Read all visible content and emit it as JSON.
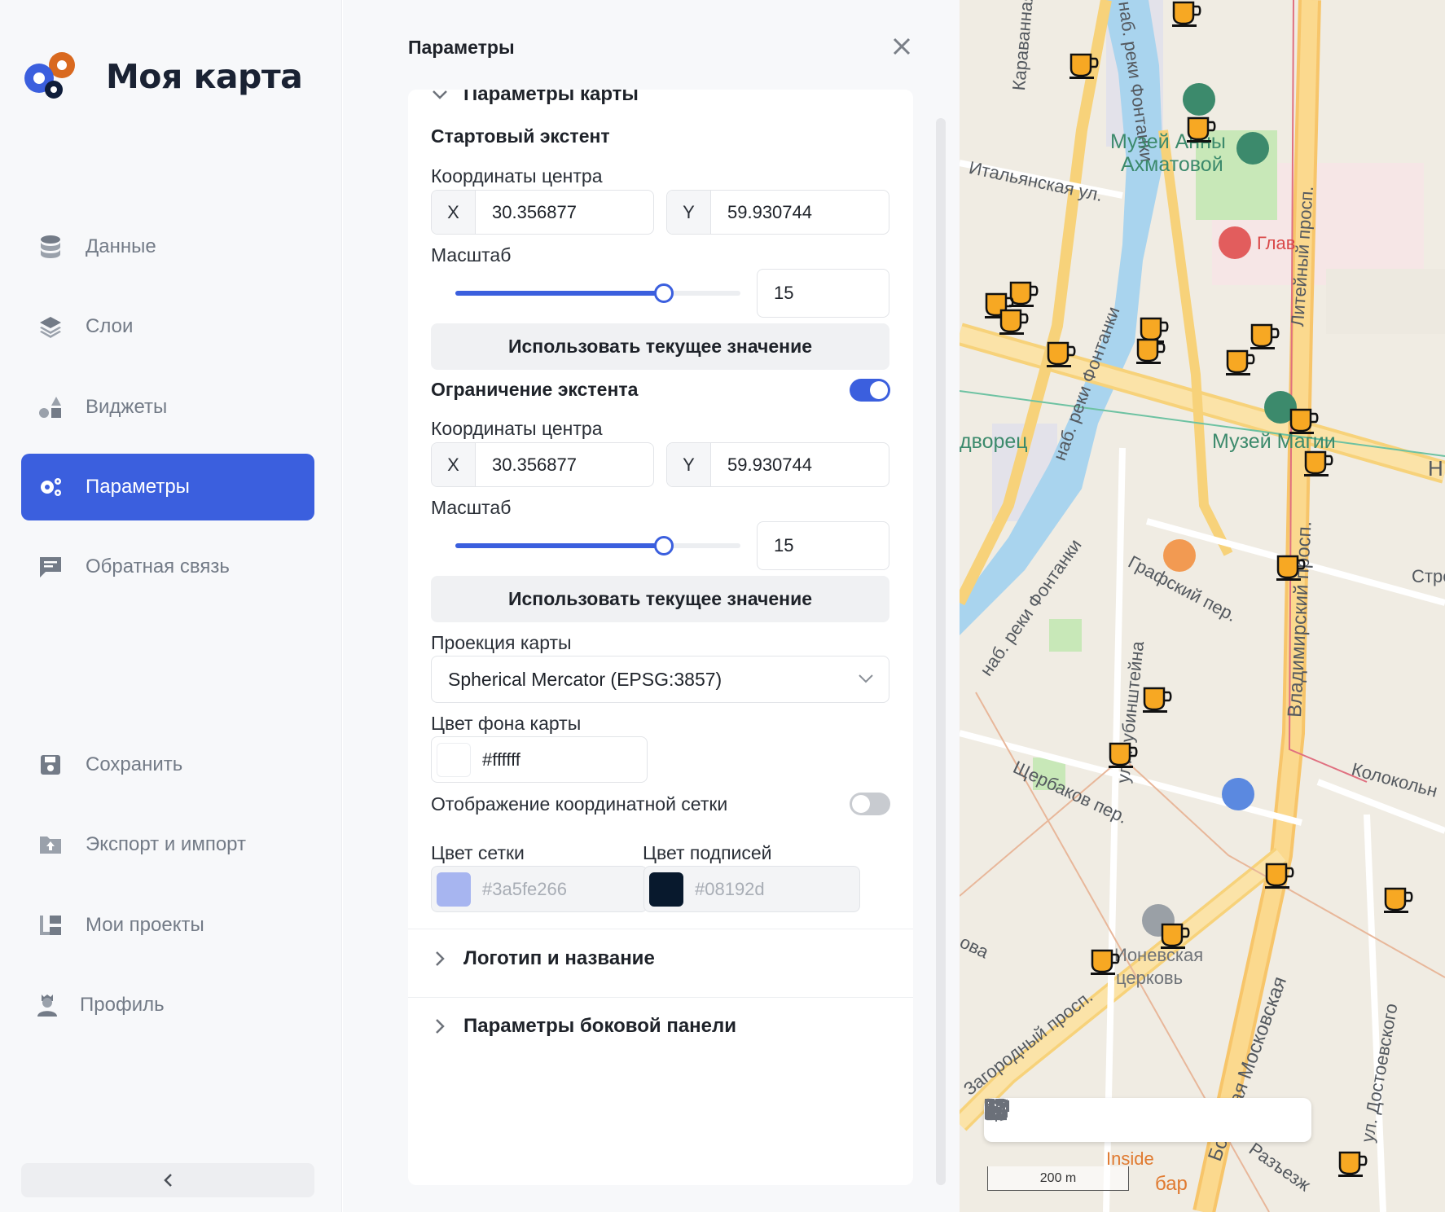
{
  "app": {
    "title": "Моя карта"
  },
  "sidebar": {
    "items": [
      {
        "label": "Данные",
        "icon": "database-icon"
      },
      {
        "label": "Слои",
        "icon": "layers-icon"
      },
      {
        "label": "Виджеты",
        "icon": "widgets-icon"
      },
      {
        "label": "Параметры",
        "icon": "settings-icon",
        "active": true
      },
      {
        "label": "Обратная связь",
        "icon": "feedback-icon"
      }
    ],
    "bottom_items": [
      {
        "label": "Сохранить",
        "icon": "save-icon"
      },
      {
        "label": "Экспорт и импорт",
        "icon": "export-import-icon"
      },
      {
        "label": "Мои проекты",
        "icon": "projects-icon"
      },
      {
        "label": "Профиль",
        "icon": "profile-icon"
      }
    ],
    "accent_color": "#3b5fde"
  },
  "panel": {
    "title": "Параметры",
    "map_params": {
      "header": "Параметры карты",
      "start_extent": {
        "title": "Стартовый экстент",
        "center_label": "Координаты центра",
        "x_prefix": "X",
        "x_value": "30.356877",
        "y_prefix": "Y",
        "y_value": "59.930744",
        "scale_label": "Масштаб",
        "scale_value": "15",
        "slider_fraction": 0.73,
        "use_current_button": "Использовать текущее значение"
      },
      "extent_limit": {
        "title": "Ограничение экстента",
        "toggle_on": true,
        "center_label": "Координаты центра",
        "x_prefix": "X",
        "x_value": "30.356877",
        "y_prefix": "Y",
        "y_value": "59.930744",
        "scale_label": "Масштаб",
        "scale_value": "15",
        "slider_fraction": 0.73,
        "use_current_button": "Использовать текущее значение"
      },
      "projection": {
        "label": "Проекция карты",
        "selected": "Spherical Mercator (EPSG:3857)"
      },
      "background": {
        "label": "Цвет фона карты",
        "value": "#ffffff"
      },
      "grid": {
        "label": "Отображение координатной сетки",
        "toggle_on": false,
        "grid_color_label": "Цвет сетки",
        "grid_color_value": "#3a5fe266",
        "labels_color_label": "Цвет подписей",
        "labels_color_value": "#08192d"
      }
    },
    "sections": [
      {
        "label": "Логотип и название"
      },
      {
        "label": "Параметры боковой панели"
      }
    ]
  },
  "map": {
    "labels": {
      "karavannaya": "Караванная ул.",
      "fontanka_top": "наб. реки Фонтанки",
      "akhmatova_1": "Музей Анны",
      "akhmatova_2": "Ахматовой",
      "italyanskaya": "Итальянская ул.",
      "glav": "Глав",
      "liteyny": "Литейный просп.",
      "fontanka_mid": "наб. реки Фонтанки",
      "dvorets": "дворец",
      "magic_museum": "Музей Магии",
      "h": "Н",
      "fontanka_low": "наб. реки Фонтанки",
      "grafsky": "Графский пер.",
      "stre": "Стре",
      "rubinshteyna": "ул. Рубинштейна",
      "vladimirsky": "Владимирский просп.",
      "shcherbakov": "Щербаков пер.",
      "kolokolnaya": "Колокольн",
      "church_1": "Ионевская",
      "church_2": "церковь",
      "ova": "ова",
      "zagorodny": "Загородный просп.",
      "moskovskaya": "Большая Московская",
      "dostoevskogo": "ул. Достоевского",
      "inside": "Inside",
      "bar": "бар",
      "razyezzhaya": "Разъезж"
    },
    "scale_label": "200 m",
    "toolbar": [
      "grid-icon",
      "select-icon",
      "chart-icon",
      "ruler-area-icon",
      "ruler-icon",
      "map-icon",
      "locate-icon"
    ]
  }
}
